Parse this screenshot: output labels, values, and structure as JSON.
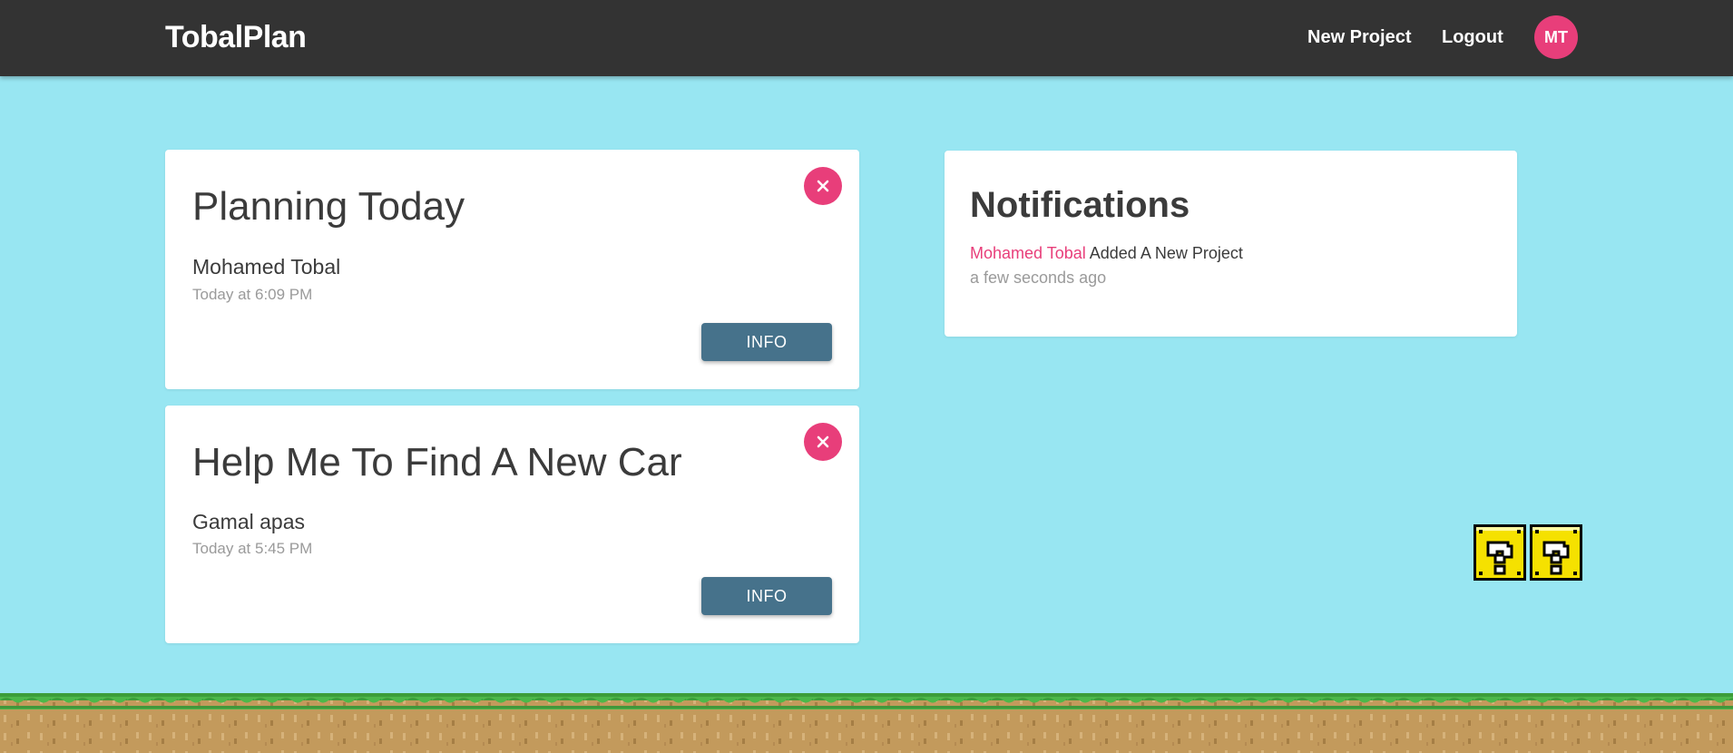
{
  "app": {
    "brand": "TobalPlan",
    "nav": {
      "new_project": "New Project",
      "logout": "Logout",
      "avatar_initials": "MT"
    }
  },
  "projects": [
    {
      "title": "Planning Today",
      "author": "Mohamed Tobal",
      "time": "Today at 6:09 PM",
      "info_label": "INFO",
      "close_icon": "close-icon"
    },
    {
      "title": "Help Me To Find A New Car",
      "author": "Gamal apas",
      "time": "Today at 5:45 PM",
      "info_label": "INFO",
      "close_icon": "close-icon"
    }
  ],
  "notifications": {
    "title": "Notifications",
    "items": [
      {
        "user": "Mohamed Tobal",
        "action": "Added A New Project",
        "time": "a few seconds ago"
      }
    ]
  },
  "colors": {
    "navbar": "#333333",
    "background": "#98e6f2",
    "accent_pink": "#e83e7a",
    "info_button": "#46728b"
  }
}
